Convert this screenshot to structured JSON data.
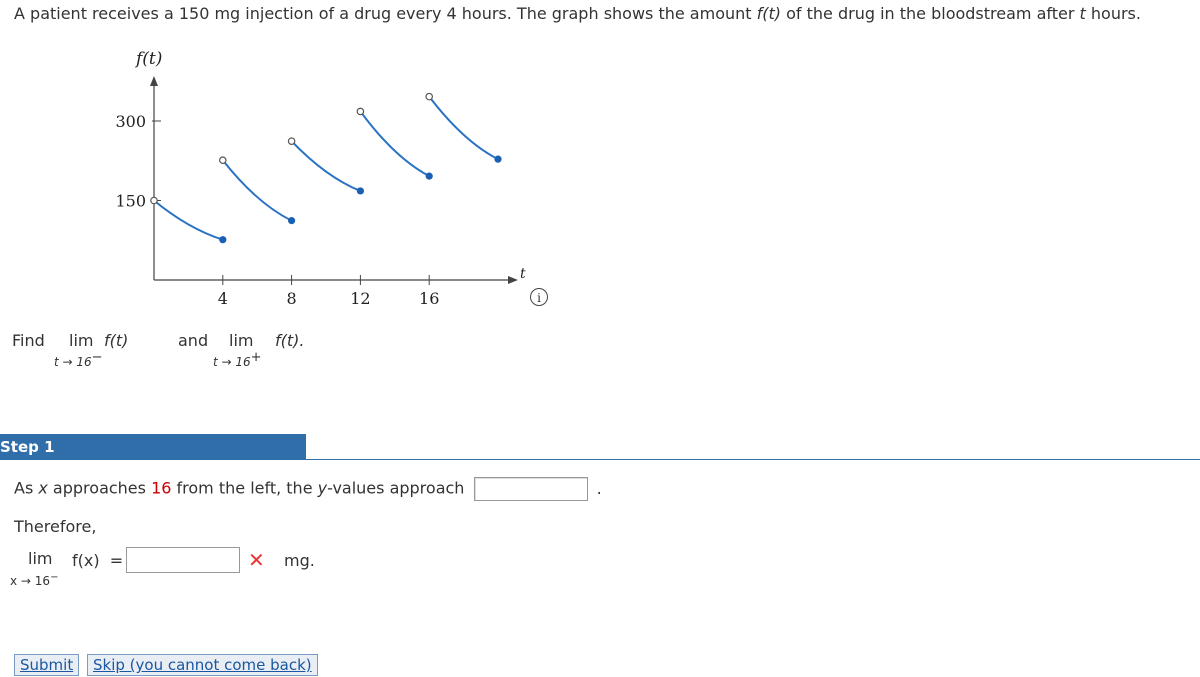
{
  "problem": {
    "text_before_ft": "A patient receives a 150 mg injection of a drug every 4 hours. The graph shows the amount ",
    "ft": "f(t)",
    "text_mid": " of the drug in the bloodstream after ",
    "t": "t",
    "text_end": " hours."
  },
  "chart_data": {
    "type": "line",
    "ylabel": "f(t)",
    "xlabel": "t",
    "x_ticks": [
      "4",
      "8",
      "12",
      "16"
    ],
    "y_ticks": [
      "150",
      "300"
    ],
    "segments": [
      {
        "x_start": 0,
        "y_start": 150,
        "x_end": 4,
        "y_end": 76,
        "open_start": true,
        "closed_end": true
      },
      {
        "x_start": 4,
        "y_start": 226,
        "x_end": 8,
        "y_end": 112,
        "open_start": true,
        "closed_end": true
      },
      {
        "x_start": 8,
        "y_start": 262,
        "x_end": 12,
        "y_end": 168,
        "open_start": true,
        "closed_end": true
      },
      {
        "x_start": 12,
        "y_start": 318,
        "x_end": 16,
        "y_end": 196,
        "open_start": true,
        "closed_end": true
      },
      {
        "x_start": 16,
        "y_start": 346,
        "x_end": 20,
        "y_end": 228,
        "open_start": true,
        "closed_end": true
      }
    ]
  },
  "find": {
    "find_label": "Find",
    "lim": "lim",
    "ft": "f(t)",
    "sub_left": "t → 16",
    "sub_left_sup": "−",
    "and_label": "and",
    "sub_right": "t → 16",
    "sub_right_sup": "+",
    "ft_end": "f(t)."
  },
  "step": {
    "label": "Step 1",
    "sentence_before": "As ",
    "x": "x",
    "sentence_mid1": " approaches ",
    "sixteen": "16",
    "sentence_mid2": " from the left, the ",
    "y": "y",
    "sentence_mid3": "-values approach",
    "period": ".",
    "therefore": "Therefore,",
    "lim": "lim",
    "fx": "f(x)  =",
    "lim_sub": "x → 16",
    "lim_sub_sup": "−",
    "units": "mg."
  },
  "buttons": {
    "submit": "Submit",
    "skip": "Skip (you cannot come back)"
  }
}
